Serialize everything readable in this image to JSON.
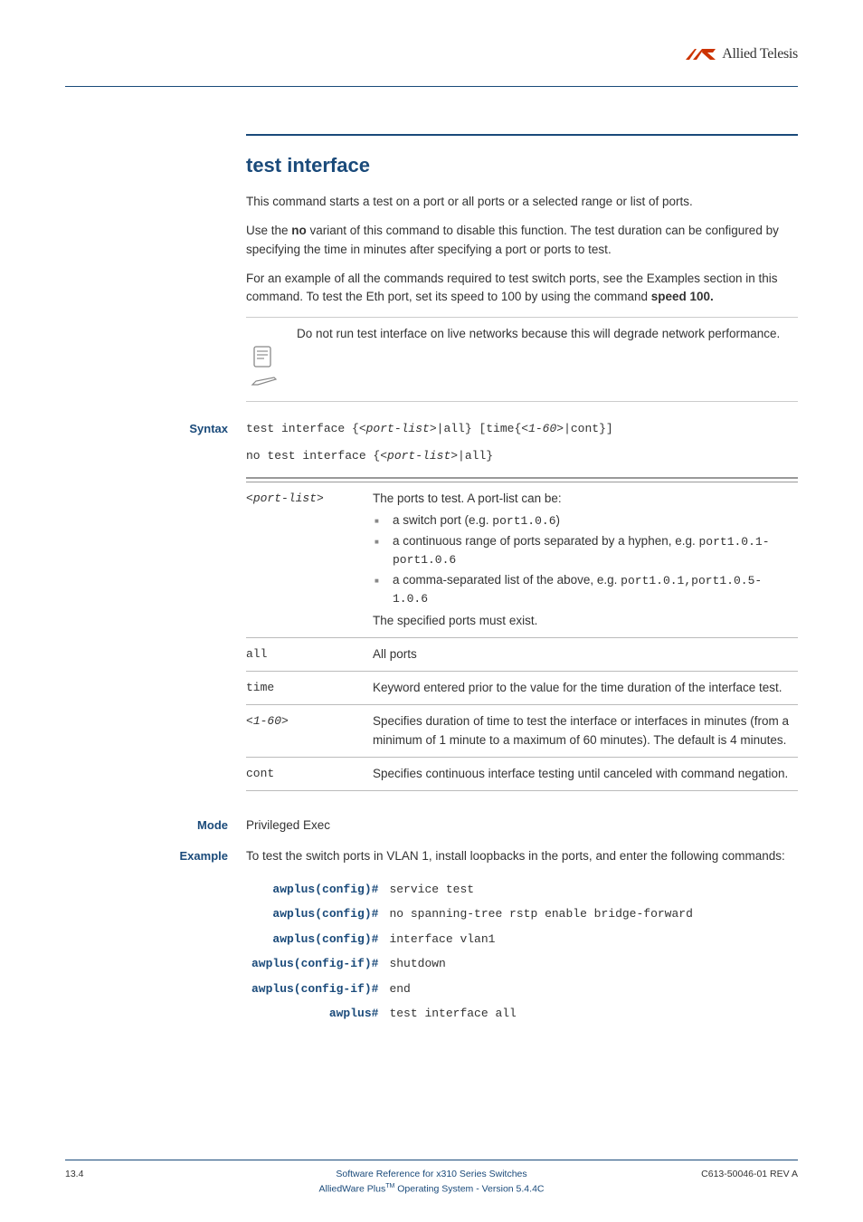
{
  "brand": {
    "name": "Allied Telesis"
  },
  "title": "test interface",
  "intro_p1": "This command starts a test on a port or all ports or a selected range or list of ports.",
  "intro_p2_pre": "Use the ",
  "intro_p2_bold": "no",
  "intro_p2_post": " variant of this command to disable this function. The test duration can be configured by specifying the time in minutes after specifying a port or ports to test.",
  "intro_p3_pre": "For an example of all the commands required to test switch ports, see the Examples section in this command. To test the Eth port, set its speed to 100 by using the command ",
  "intro_p3_bold": "speed 100.",
  "note_text": "Do not run test interface on live networks because this will degrade network performance.",
  "labels": {
    "syntax": "Syntax",
    "mode": "Mode",
    "example": "Example"
  },
  "syntax": {
    "line1_a": "test interface {<",
    "line1_b": "port-list",
    "line1_c": ">|all} [time{<",
    "line1_d": "1-60",
    "line1_e": ">|cont}]",
    "line2_a": "no test interface {<",
    "line2_b": "port-list",
    "line2_c": ">|all}"
  },
  "params": {
    "port_list_name_a": "<",
    "port_list_name_b": "port-list",
    "port_list_name_c": ">",
    "port_list_desc_top": "The ports to test. A port-list can be:",
    "port_list_b1_a": "a switch port (e.g. ",
    "port_list_b1_b": "port1.0.6",
    "port_list_b1_c": ")",
    "port_list_b2_a": "a continuous range of ports separated by a hyphen, e.g. ",
    "port_list_b2_b": "port1.0.1-port1.0.6",
    "port_list_b3_a": "a comma-separated list of the above, e.g. ",
    "port_list_b3_b": "port1.0.1,port1.0.5-1.0.6",
    "port_list_desc_bottom": "The specified ports must exist.",
    "all_name": "all",
    "all_desc": "All ports",
    "time_name": "time",
    "time_desc": "Keyword entered prior to the value for the time duration of the interface test.",
    "range_name_a": "<",
    "range_name_b": "1-60",
    "range_name_c": ">",
    "range_desc": "Specifies duration of time to test the interface or interfaces in minutes (from a minimum of 1 minute to a maximum of 60 minutes). The default is 4 minutes.",
    "cont_name": "cont",
    "cont_desc": "Specifies continuous interface testing until canceled with command negation."
  },
  "mode_value": "Privileged Exec",
  "example_intro": "To test the switch ports in VLAN 1, install loopbacks in the ports, and enter the following commands:",
  "example_cmds": [
    {
      "prompt": "awplus(config)#",
      "cmd": "service test"
    },
    {
      "prompt": "awplus(config)#",
      "cmd": "no spanning-tree rstp enable bridge-forward"
    },
    {
      "prompt": "awplus(config)#",
      "cmd": "interface vlan1"
    },
    {
      "prompt": "awplus(config-if)#",
      "cmd": "shutdown"
    },
    {
      "prompt": "awplus(config-if)#",
      "cmd": "end"
    },
    {
      "prompt": "awplus#",
      "cmd": "test interface all"
    }
  ],
  "footer": {
    "page": "13.4",
    "line1": "Software Reference for x310 Series Switches",
    "line2_a": "AlliedWare Plus",
    "line2_tm": "TM",
    "line2_b": " Operating System  - Version 5.4.4C",
    "right": "C613-50046-01 REV A"
  }
}
